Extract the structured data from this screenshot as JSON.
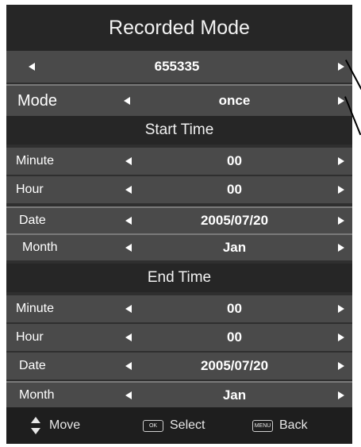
{
  "title": "Recorded Mode",
  "channel": {
    "value": "655335"
  },
  "mode": {
    "label": "Mode",
    "value": "once"
  },
  "start": {
    "header": "Start Time",
    "rows": [
      {
        "label": "Minute",
        "value": "00"
      },
      {
        "label": "Hour",
        "value": "00"
      },
      {
        "label": "Date",
        "value": "2005/07/20"
      },
      {
        "label": "Month",
        "value": "Jan"
      }
    ]
  },
  "end": {
    "header": "End Time",
    "rows": [
      {
        "label": "Minute",
        "value": "00"
      },
      {
        "label": "Hour",
        "value": "00"
      },
      {
        "label": "Date",
        "value": "2005/07/20"
      },
      {
        "label": "Month",
        "value": "Jan"
      }
    ]
  },
  "footer": {
    "move": "Move",
    "select": "Select",
    "select_key": "OK",
    "back": "Back",
    "back_key": "MENU"
  },
  "icons": {
    "left": "left-arrow-icon",
    "right": "right-arrow-icon",
    "updown": "up-down-arrow-icon"
  },
  "colors": {
    "panel": "#2f2f2f",
    "row": "#4a4a4a",
    "header": "#262626",
    "text": "#ffffff"
  }
}
